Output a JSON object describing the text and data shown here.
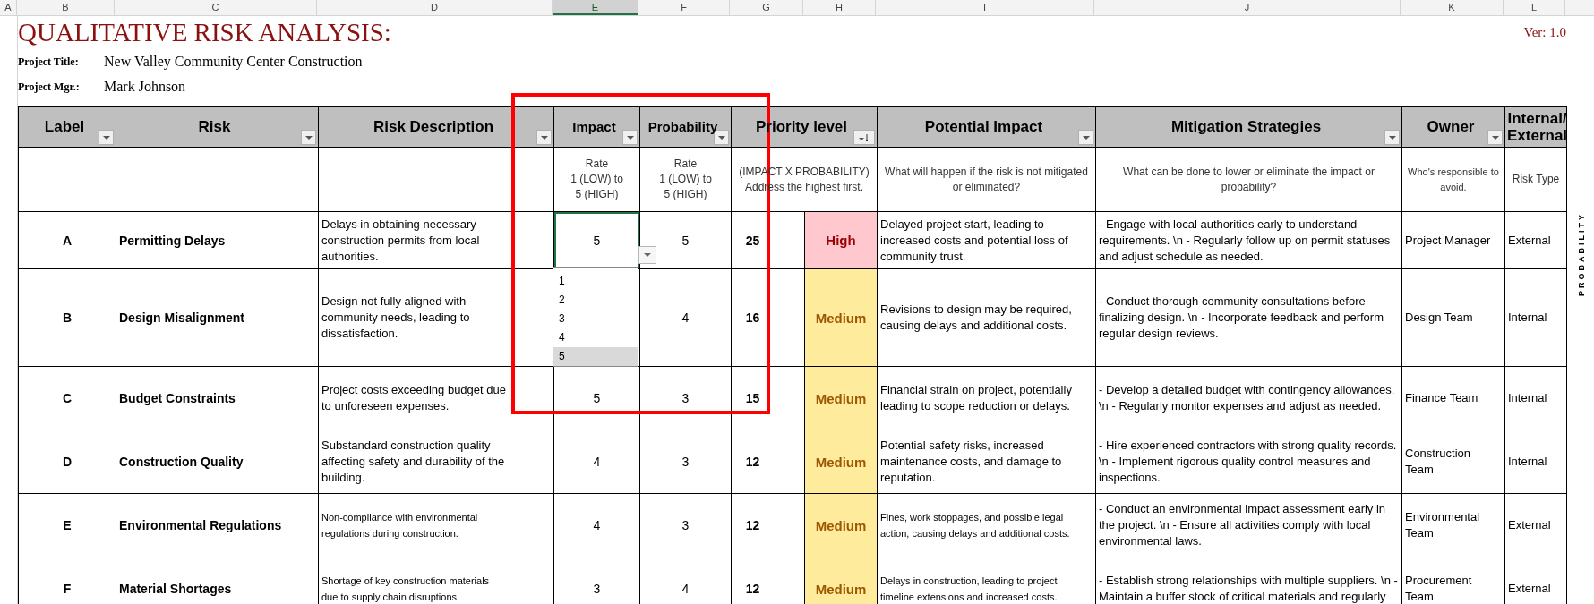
{
  "column_letters": [
    {
      "label": "A",
      "selected": false
    },
    {
      "label": "B",
      "selected": false
    },
    {
      "label": "C",
      "selected": false
    },
    {
      "label": "D",
      "selected": false
    },
    {
      "label": "E",
      "selected": true
    },
    {
      "label": "F",
      "selected": false
    },
    {
      "label": "G",
      "selected": false
    },
    {
      "label": "H",
      "selected": false
    },
    {
      "label": "I",
      "selected": false
    },
    {
      "label": "J",
      "selected": false
    },
    {
      "label": "K",
      "selected": false
    },
    {
      "label": "L",
      "selected": false
    }
  ],
  "title": "QUALITATIVE RISK ANALYSIS:",
  "version": "Ver: 1.0",
  "project_fields": [
    {
      "label": "Project Title:",
      "value": "New Valley Community Center Construction"
    },
    {
      "label": "Project Mgr.:",
      "value": "Mark Johnson"
    }
  ],
  "table": {
    "columns": [
      {
        "heading": "Label",
        "filter_button": true,
        "sorted": false
      },
      {
        "heading": "Risk",
        "filter_button": true,
        "sorted": false
      },
      {
        "heading": "Risk Description",
        "filter_button": true,
        "sorted": false
      },
      {
        "heading": "Impact",
        "filter_button": true,
        "sorted": false,
        "note": "Rate\n1 (LOW) to\n5 (HIGH)"
      },
      {
        "heading": "Probability",
        "filter_button": true,
        "sorted": false,
        "note": "Rate\n1 (LOW) to\n5 (HIGH)"
      },
      {
        "heading": "Priority level",
        "filter_button": true,
        "sorted": true,
        "note": "(IMPACT X PROBABILITY)\nAddress the  highest first."
      },
      {
        "heading": "Potential Impact",
        "filter_button": true,
        "sorted": false,
        "note": "What will happen if the risk is not mitigated or eliminated?"
      },
      {
        "heading": "Mitigation Strategies",
        "filter_button": true,
        "sorted": false,
        "note": "What can be done to lower or eliminate the impact or probability?"
      },
      {
        "heading": "Owner",
        "filter_button": true,
        "sorted": false,
        "note": "Who's responsible to avoid."
      },
      {
        "heading": "Internal/ External",
        "filter_button": false,
        "note": "Risk Type"
      }
    ],
    "rows": [
      {
        "label": "A",
        "risk": "Permitting Delays",
        "description": "Delays in obtaining necessary construction permits from local authorities.",
        "impact": "5",
        "impact_active": true,
        "probability": "5",
        "score": "25",
        "priority": {
          "text": "High",
          "kind": "high"
        },
        "potential_impact": "Delayed project start, leading to increased costs and potential loss of community trust.",
        "mitigation": "- Engage with local authorities early to understand requirements. \\n - Regularly follow up on permit statuses and adjust schedule as needed.",
        "owner": "Project Manager",
        "type": "External"
      },
      {
        "label": "B",
        "risk": "Design Misalignment",
        "description": "Design not fully aligned with community needs, leading to dissatisfaction.",
        "probability": "4",
        "score": "16",
        "priority": {
          "text": "Medium",
          "kind": "medium"
        },
        "potential_impact": "Revisions to design may be required, causing delays and additional costs.",
        "mitigation": "- Conduct thorough community consultations before finalizing design. \\n - Incorporate feedback and perform regular design reviews.",
        "owner": "Design Team",
        "type": "Internal"
      },
      {
        "label": "C",
        "risk": "Budget Constraints",
        "description": "Project costs exceeding budget due to unforeseen expenses.",
        "impact": "5",
        "impact_active": false,
        "probability": "3",
        "score": "15",
        "priority": {
          "text": "Medium",
          "kind": "medium"
        },
        "potential_impact": "Financial strain on project, potentially leading to scope reduction or delays.",
        "mitigation": "- Develop a detailed budget with contingency allowances. \\n - Regularly monitor expenses and adjust as needed.",
        "owner": "Finance Team",
        "type": "Internal"
      },
      {
        "label": "D",
        "risk": "Construction Quality",
        "description": "Substandard construction quality affecting safety and durability of the building.",
        "impact": "4",
        "impact_active": false,
        "probability": "3",
        "score": "12",
        "priority": {
          "text": "Medium",
          "kind": "medium"
        },
        "potential_impact": "Potential safety risks, increased maintenance costs, and damage to reputation.",
        "mitigation": "- Hire experienced contractors with strong quality records. \\n - Implement rigorous quality control measures and inspections.",
        "owner": "Construction Team",
        "type": "Internal"
      },
      {
        "label": "E",
        "risk": "Environmental Regulations",
        "description": "Non-compliance with environmental regulations during construction.",
        "impact": "4",
        "impact_active": false,
        "probability": "3",
        "score": "12",
        "priority": {
          "text": "Medium",
          "kind": "medium"
        },
        "potential_impact": "Fines, work stoppages, and possible legal action, causing delays and additional costs.",
        "mitigation": "- Conduct an environmental impact assessment early in the project. \\n - Ensure all activities comply with local environmental laws.",
        "owner": "Environmental Team",
        "type": "External"
      },
      {
        "label": "F",
        "risk": "Material Shortages",
        "description": "Shortage of key construction materials due to supply chain disruptions.",
        "impact": "3",
        "impact_active": false,
        "probability": "4",
        "score": "12",
        "priority": {
          "text": "Medium",
          "kind": "medium"
        },
        "potential_impact": "Delays in construction, leading to project timeline extensions and increased costs.",
        "mitigation": "- Establish strong relationships with multiple suppliers. \\n - Maintain a buffer stock of critical materials and regularly",
        "owner": "Procurement Team",
        "type": "External"
      }
    ]
  },
  "dropdown": {
    "options": [
      {
        "label": "1",
        "selected": false
      },
      {
        "label": "2",
        "selected": false
      },
      {
        "label": "3",
        "selected": false
      },
      {
        "label": "4",
        "selected": false
      },
      {
        "label": "5",
        "selected": true
      }
    ]
  },
  "side_label": "PROBABILITY"
}
